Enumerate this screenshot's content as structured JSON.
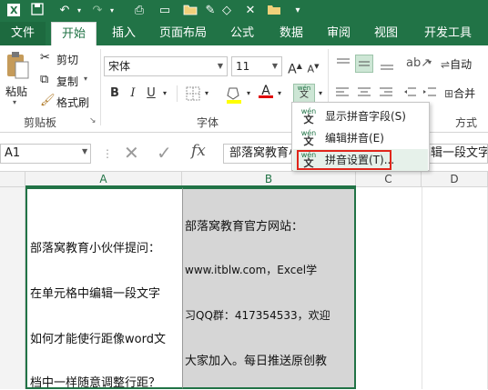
{
  "tabs": {
    "file": "文件",
    "home": "开始",
    "insert": "插入",
    "page_layout": "页面布局",
    "formulas": "公式",
    "data": "数据",
    "review": "审阅",
    "view": "视图",
    "developer": "开发工具"
  },
  "ribbon": {
    "clipboard": {
      "paste": "粘贴",
      "cut": "剪切",
      "copy": "复制",
      "format_painter": "格式刷",
      "group_label": "剪贴板"
    },
    "font": {
      "font_name": "宋体",
      "font_size": "11",
      "group_label": "字体",
      "bold": "B",
      "italic": "I",
      "underline": "U",
      "grow": "A",
      "shrink": "A"
    },
    "alignment": {
      "wrap_text": "自动",
      "merge": "合并",
      "group_label_partial": "方式"
    }
  },
  "formula_bar": {
    "name_box": "A1",
    "content": "部落窝教育小伙伴提问：在单元格中编辑一段文字"
  },
  "columns": [
    "A",
    "B",
    "C",
    "D"
  ],
  "cells": {
    "A1": [
      "部落窝教育小伙伴提问：",
      "在单元格中编辑一段文字",
      "如何才能使行距像word文",
      "档中一样随意调整行距？"
    ],
    "B1": [
      "部落窝教育官方网站：",
      "www.itblw.com，Excel学",
      "习QQ群：417354533，欢迎",
      "大家加入。每日推送原创教"
    ]
  },
  "phonetic_menu": {
    "items": [
      {
        "label": "显示拼音字段(S)"
      },
      {
        "label": "编辑拼音(E)"
      },
      {
        "label": "拼音设置(T)..."
      }
    ],
    "icon_top": "wén",
    "icon_bottom": "文"
  },
  "colors": {
    "excel_green": "#217346",
    "highlight_box": "#e0261b",
    "cell_b_fill": "#d6d6d6"
  }
}
